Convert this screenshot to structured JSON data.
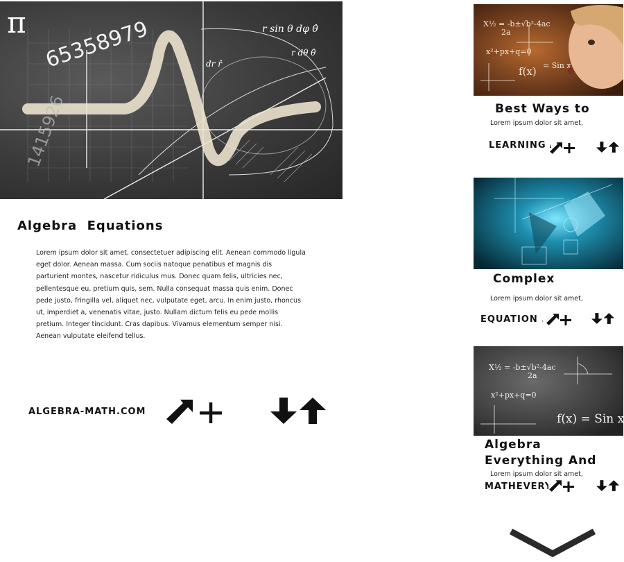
{
  "hero": {
    "pi_symbol": "π",
    "formula_top": "r sin θ dφ θ̂",
    "formula_right": "r dθ θ̂",
    "formula_dr": "dr r̂",
    "digits": "65358979",
    "side_digits": "1415926"
  },
  "main": {
    "title": "Algebra  Equations",
    "body": "Lorem ipsum dolor sit amet, consectetuer adipiscing elit. Aenean commodo ligula eget dolor. Aenean massa. Cum sociis natoque penatibus et magnis dis parturient montes, nascetur ridiculus mus. Donec quam felis, ultricies nec, pellentesque eu, pretium quis, sem. Nulla consequat massa quis enim. Donec pede justo, fringilla vel, aliquet nec, vulputate eget, arcu. In enim justo, rhoncus ut, imperdiet a, venenatis vitae, justo. Nullam dictum felis eu pede mollis pretium. Integer tincidunt. Cras dapibus. Vivamus elementum semper nisi. Aenean vulputate eleifend tellus.",
    "link": "ALGEBRA-MATH.COM"
  },
  "cards": [
    {
      "title": "Best Ways to",
      "excerpt": "Lorem ipsum dolor sit amet,",
      "link": "LEARNING ALGEBRA",
      "image_formulas": [
        "X½ = -b±√b²-4ac / 2a",
        "x²+px+q=0",
        "f(x) = Sin x"
      ]
    },
    {
      "title": "Complex",
      "excerpt": "Lorem ipsum dolor sit amet,",
      "link": "EQUATION .COM"
    },
    {
      "title": "Algebra\nEverything And",
      "excerpt": "Lorem ipsum dolor sit amet,",
      "link": "MATHEVERYTHING.COM",
      "image_formulas": [
        "X½ = -b±√b²-4ac / 2a",
        "x²+px+q=0",
        "f(x) = Sin x"
      ]
    }
  ],
  "icons": {
    "expand": "expand-arrow-icon",
    "add": "plus-icon",
    "sort": "sort-arrows-icon",
    "scroll": "chevron-down-icon"
  },
  "colors": {
    "text": "#111111",
    "chalkboard": "#3a3a3a",
    "card1_bg": "#6b3a1c",
    "card2_bg": "#0b3d4f"
  }
}
